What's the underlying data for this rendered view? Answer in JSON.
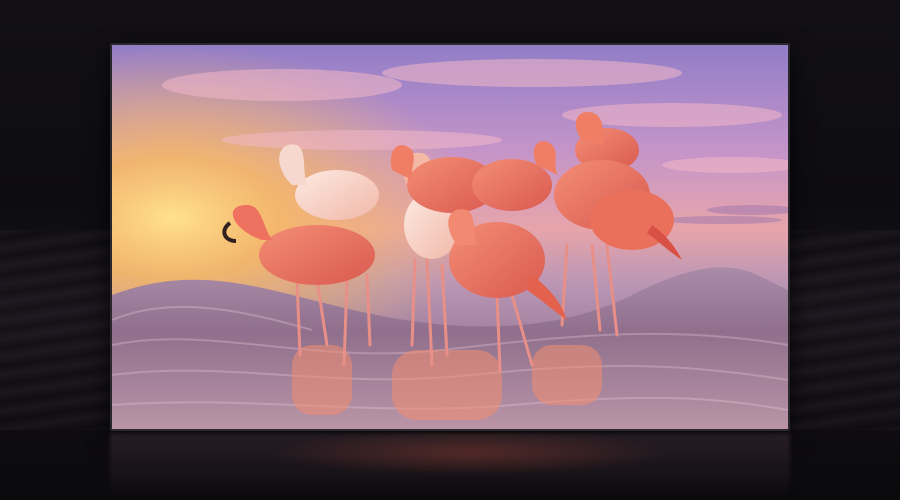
{
  "image": {
    "subject": "",
    "colors": {
      "sky_top": "#9d7fc7",
      "sky_mid": "#d98fb0",
      "sun_glow": "#f7c15a",
      "water": "#8f7088",
      "flamingo": "#f07a5f",
      "flamingo_light": "#f7c2b0",
      "frame": "#2a282c",
      "background": "#0b0a0d"
    }
  }
}
